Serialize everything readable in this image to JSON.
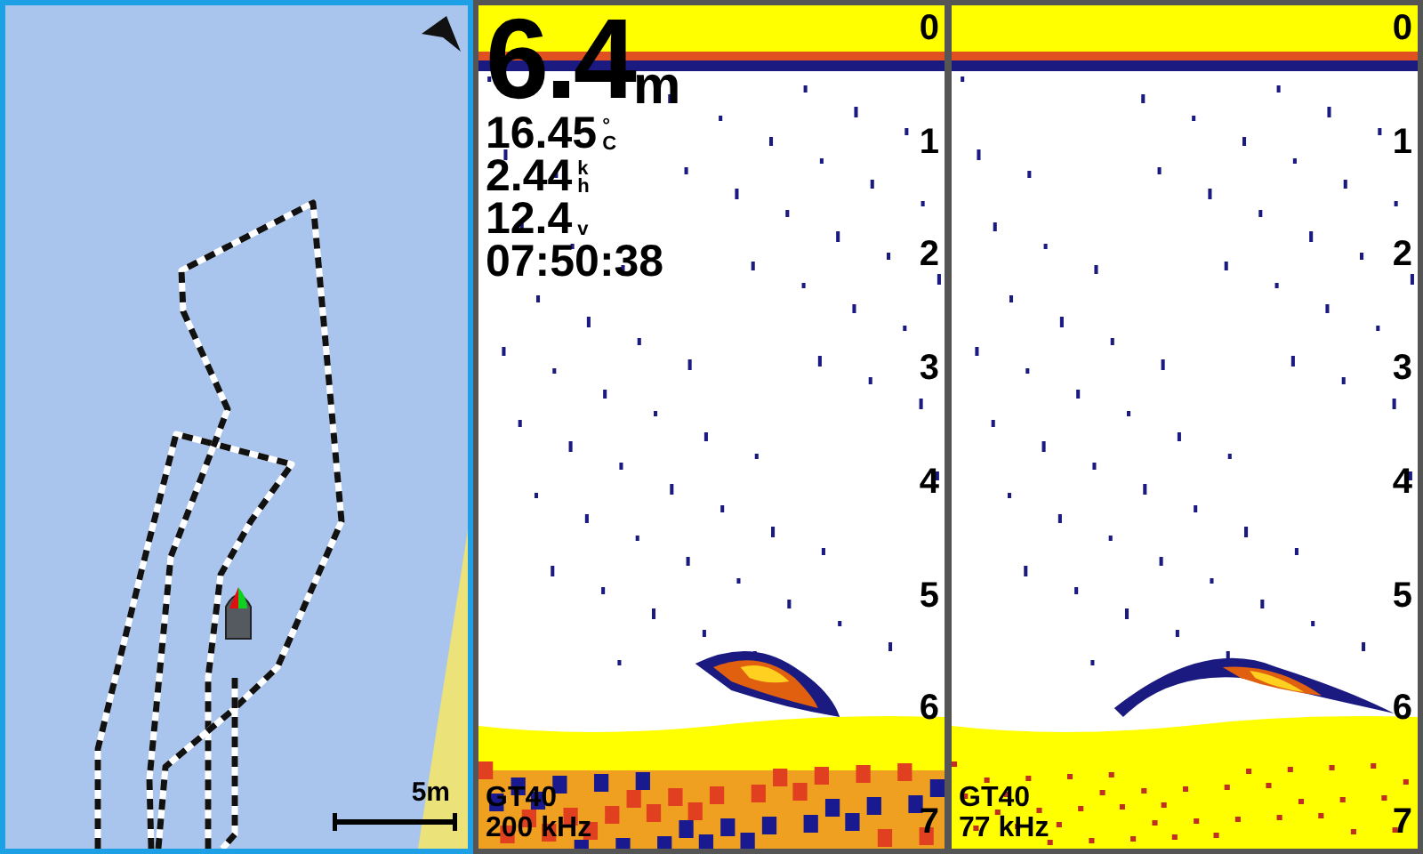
{
  "map": {
    "scale_label": "5m"
  },
  "readouts": {
    "depth": "6.4",
    "depth_unit": "m",
    "lines": [
      {
        "value": "16.45",
        "unit_lines": [
          "°",
          "C"
        ]
      },
      {
        "value": "2.44",
        "unit_lines": [
          "k",
          "h"
        ]
      },
      {
        "value": "12.4",
        "unit_lines": [
          "v"
        ]
      },
      {
        "value": "07:50:38"
      }
    ]
  },
  "sonar_panes": [
    {
      "transducer": "GT40",
      "frequency": "200 kHz",
      "depth_scale": [
        "0",
        "1",
        "2",
        "3",
        "4",
        "5",
        "6",
        "7"
      ]
    },
    {
      "transducer": "GT40",
      "frequency": "77 kHz",
      "depth_scale": [
        "0",
        "1",
        "2",
        "3",
        "4",
        "5",
        "6",
        "7"
      ]
    }
  ]
}
